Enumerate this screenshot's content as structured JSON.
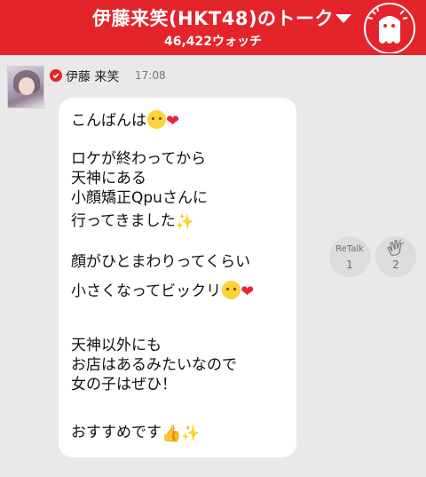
{
  "header": {
    "title": "伊藤来笑(HKT48)のトーク",
    "watch_count": "46,422ウォッチ"
  },
  "message": {
    "sender": "伊藤 来笑",
    "time": "17:08",
    "lines": {
      "l1": "こんばんは",
      "l2": "ロケが終わってから",
      "l3": "天神にある",
      "l4": "小顔矯正Qpuさんに",
      "l5": "行ってきました",
      "l6": "顔がひとまわりってくらい",
      "l7": "小さくなってビックリ",
      "l8": "天神以外にも",
      "l9": "お店はあるみたいなので",
      "l10": "女の子はぜひ！",
      "l11": "おすすめです"
    }
  },
  "actions": {
    "retalk_label": "ReTalk",
    "retalk_count": "1",
    "clap_count": "2"
  },
  "colors": {
    "header_bg": "#e3242b",
    "background": "#e9e9e9",
    "bubble": "#ffffff"
  },
  "icons": {
    "dropdown": "chevron-down-icon",
    "mascot": "ghost-mascot-icon",
    "verified": "verified-badge-icon",
    "clap": "clap-hands-icon"
  }
}
